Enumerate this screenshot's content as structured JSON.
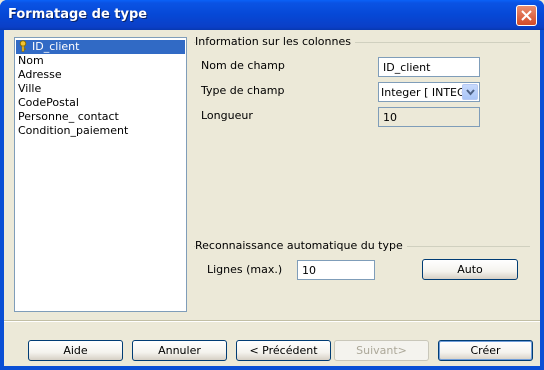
{
  "window": {
    "title": "Formatage de type"
  },
  "columns_list": [
    {
      "label": "ID_client",
      "primary_key": true,
      "selected": true
    },
    {
      "label": "Nom"
    },
    {
      "label": "Adresse"
    },
    {
      "label": "Ville"
    },
    {
      "label": "CodePostal"
    },
    {
      "label": "Personne_ contact"
    },
    {
      "label": "Condition_paiement"
    }
  ],
  "column_info": {
    "group_title": "Information sur les colonnes",
    "field_name_label": "Nom de champ",
    "field_name_value": "ID_client",
    "field_type_label": "Type de champ",
    "field_type_value": "Integer [ INTEGER ]",
    "length_label": "Longueur",
    "length_value": "10"
  },
  "auto_detect": {
    "group_title": "Reconnaissance automatique du type",
    "lines_label": "Lignes (max.)",
    "lines_value": "10",
    "auto_button": "Auto"
  },
  "buttons": {
    "help": "Aide",
    "cancel": "Annuler",
    "previous": "< Précédent",
    "next": "Suivant>",
    "create": "Créer"
  },
  "colors": {
    "titlebar": "#0a53e4",
    "selection": "#316ac5",
    "dialog_bg": "#ece9d8"
  },
  "icons": {
    "close": "close-icon",
    "key": "key-icon",
    "dropdown": "chevron-down-icon"
  }
}
